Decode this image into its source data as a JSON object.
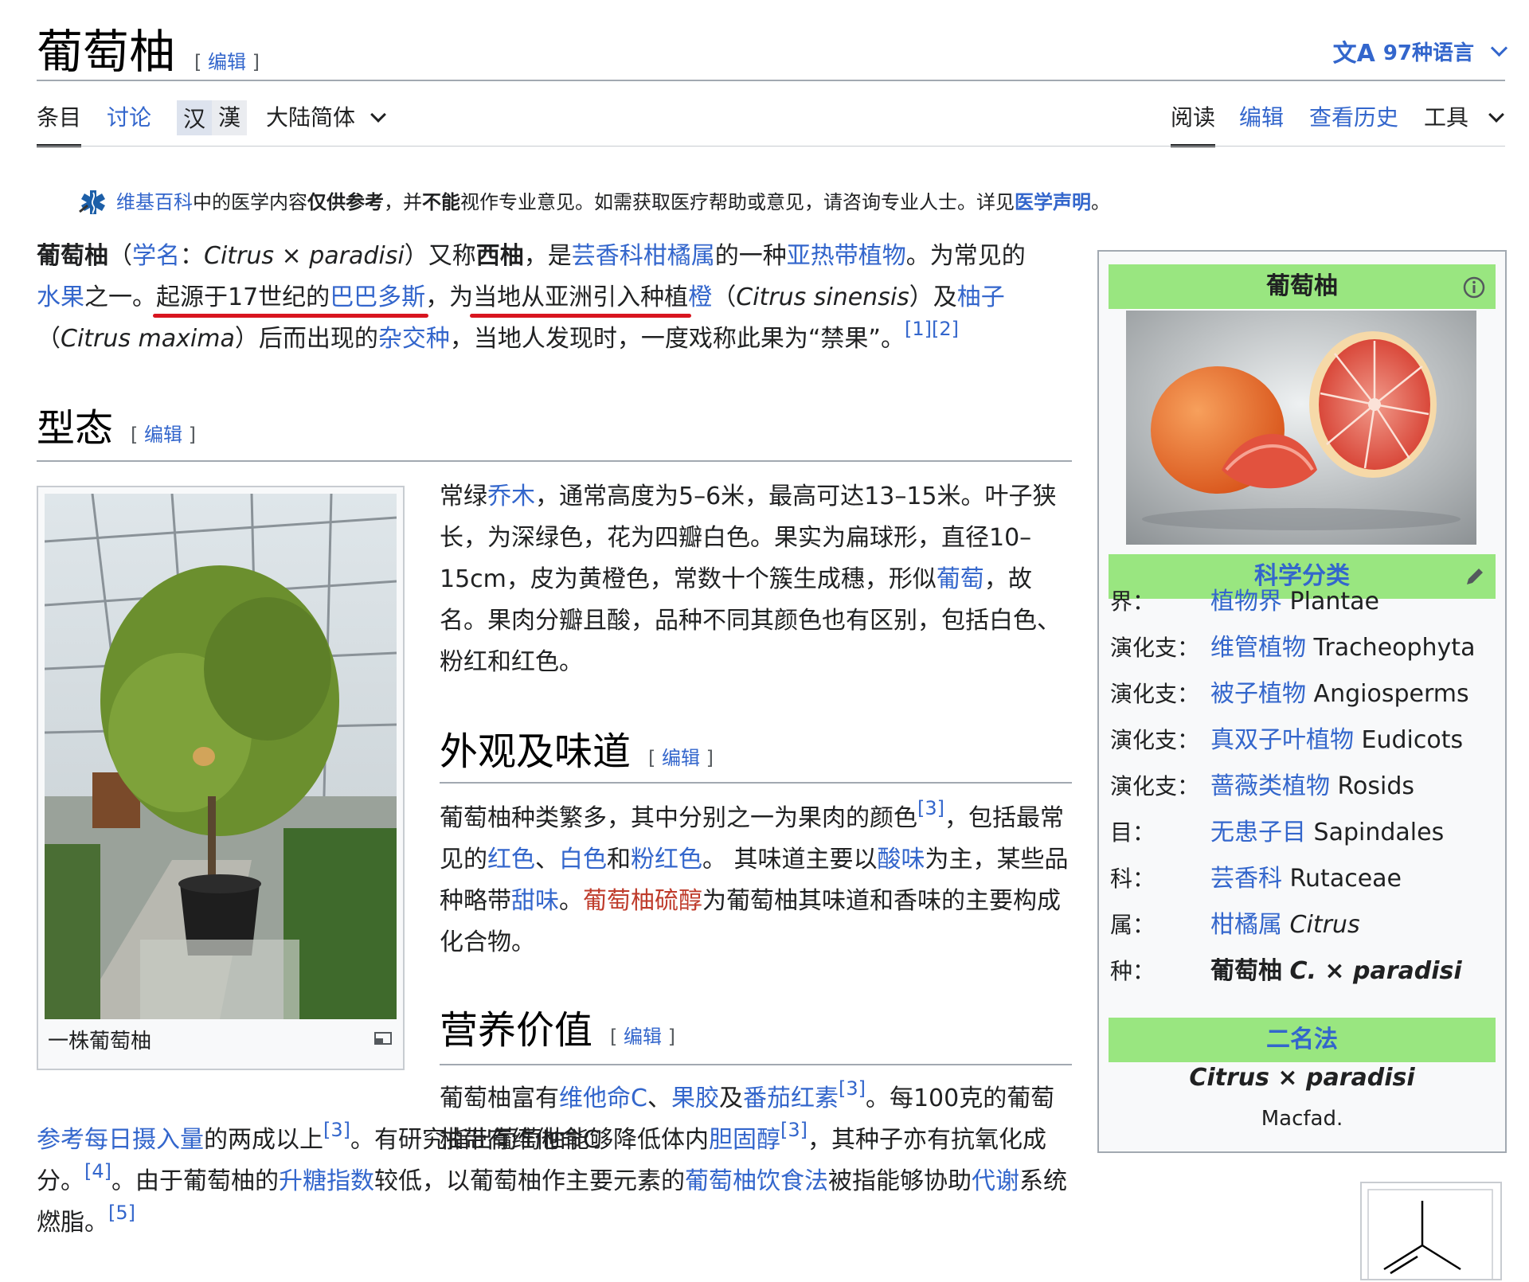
{
  "header": {
    "title": "葡萄柚",
    "edit_bracket_open": "[",
    "edit_label": "编辑",
    "edit_bracket_close": "]",
    "lang_icon": "文A",
    "lang_label": "97种语言"
  },
  "tabs": {
    "article": "条目",
    "talk": "讨论",
    "variant_simplified": "汉",
    "variant_traditional": "漢",
    "variant_select": "大陆简体",
    "read": "阅读",
    "edit": "编辑",
    "history": "查看历史",
    "tools": "工具"
  },
  "notice": {
    "wiki_link": "维基百科",
    "t1": "中的医学内容",
    "b1": "仅供参考",
    "t2": "，并",
    "b2": "不能",
    "t3": "视作专业意见。如需获取医疗帮助或意见，请咨询专业人士。详见",
    "disclaimer_link": "医学声明",
    "t4": "。"
  },
  "intro": {
    "b_name": "葡萄柚",
    "p1": "（",
    "l_sci": "学名",
    "p2": "：",
    "sci": "Citrus × paradisi",
    "p3": "）又称",
    "b_alt": "西柚",
    "p4": "，是",
    "l_family": "芸香科柑橘属",
    "p5": "的一种",
    "l_subtrop": "亚热带植物",
    "p6": "。为常见的",
    "l_fruit": "水果",
    "p7": "之一。",
    "u1a": "起源于17世纪的",
    "u1b": "巴巴多斯",
    "p8": "，为",
    "u2": "当地从亚洲引入种植",
    "l_orange": "橙",
    "p9": "（",
    "sinensis": "Citrus sinensis",
    "p10": "）及",
    "l_pomelo": "柚子",
    "p11": "（",
    "maxima": "Citrus maxima",
    "p12": "）后而出现的",
    "l_hybrid": "杂交种",
    "p13": "，当地人发现时，一度戏称此果为“禁果”。",
    "ref1": "[1]",
    "ref2": "[2]"
  },
  "sections": {
    "morph": "型态",
    "appearance": "外观及味道",
    "nutrition": "营养价值"
  },
  "morph_text": {
    "t1": "常绿",
    "l_tree": "乔木",
    "t2": "，通常高度为5–6米，最高可达13–15米。叶子狭长，为深绿色，花为四瓣白色。果实为扁球形，直径10–15cm，皮为黄橙色，常数十个簇生成穗，形似",
    "l_grape": "葡萄",
    "t3": "，故名。果肉分瓣且酸，品种不同其颜色也有区别，包括白色、粉红和红色。"
  },
  "appearance_text": {
    "t1": "葡萄柚种类繁多，其中分别之一为果肉的颜色",
    "ref3": "[3]",
    "t2": "，包括最常见的",
    "l_red": "红色",
    "sep1": "、",
    "l_white": "白色",
    "t3": "和",
    "l_pink": "粉红色",
    "t4": "。 其味道主要以",
    "l_sour": "酸味",
    "t5": "为主，某些品种略带",
    "l_sweet": "甜味",
    "t6": "。",
    "l_thiol": "葡萄柚硫醇",
    "t7": "为葡萄柚其味道和香味的主要构成化合物。"
  },
  "nutrition_text": {
    "t1": "葡萄柚富有",
    "l_vc": "维他命C",
    "sep1": "、",
    "l_pectin": "果胶",
    "t2": "及",
    "l_lyco": "番茄红素",
    "ref3": "[3]",
    "t3": "。每100克的葡萄柚带有维他命C",
    "l_rdi": "参考每日摄入量",
    "t4": "的两成以上",
    "ref3b": "[3]",
    "t5": "。有研究指出葡萄柚能够降低体内",
    "l_chol": "胆固醇",
    "ref3c": "[3]",
    "t6": "，其种子亦有抗氧化成分。",
    "ref4": "[4]",
    "t7": "。由于葡萄柚的",
    "l_gi": "升糖指数",
    "t8": "较低，以葡萄柚作主要元素的",
    "l_diet": "葡萄柚饮食法",
    "t9": "被指能够协助",
    "l_metab": "代谢",
    "t10": "系统燃脂。",
    "ref5": "[5]"
  },
  "figure": {
    "caption": "一株葡萄柚"
  },
  "infobox": {
    "title": "葡萄柚",
    "taxonomy_header": "科学分类",
    "rows": [
      {
        "k": "界：",
        "link": "植物界",
        "latin": "Plantae"
      },
      {
        "k": "演化支：",
        "link": "维管植物",
        "latin": "Tracheophyta"
      },
      {
        "k": "演化支：",
        "link": "被子植物",
        "latin": "Angiosperms"
      },
      {
        "k": "演化支：",
        "link": "真双子叶植物",
        "latin": "Eudicots"
      },
      {
        "k": "演化支：",
        "link": "蔷薇类植物",
        "latin": "Rosids"
      },
      {
        "k": "目：",
        "link": "无患子目",
        "latin": "Sapindales"
      },
      {
        "k": "科：",
        "link": "芸香科",
        "latin": "Rutaceae"
      },
      {
        "k": "属：",
        "link": "柑橘属",
        "latin": "Citrus"
      },
      {
        "k": "种：",
        "link": "葡萄柚",
        "latin": "C. × paradisi"
      }
    ],
    "binomial_header": "二名法",
    "binomial": "Citrus × paradisi",
    "authority": "Macfad."
  },
  "colors": {
    "link": "#3366cc",
    "red_link": "#bf3c2c",
    "infobox_header": "#99e680",
    "underline_annotation": "#d8151f"
  }
}
